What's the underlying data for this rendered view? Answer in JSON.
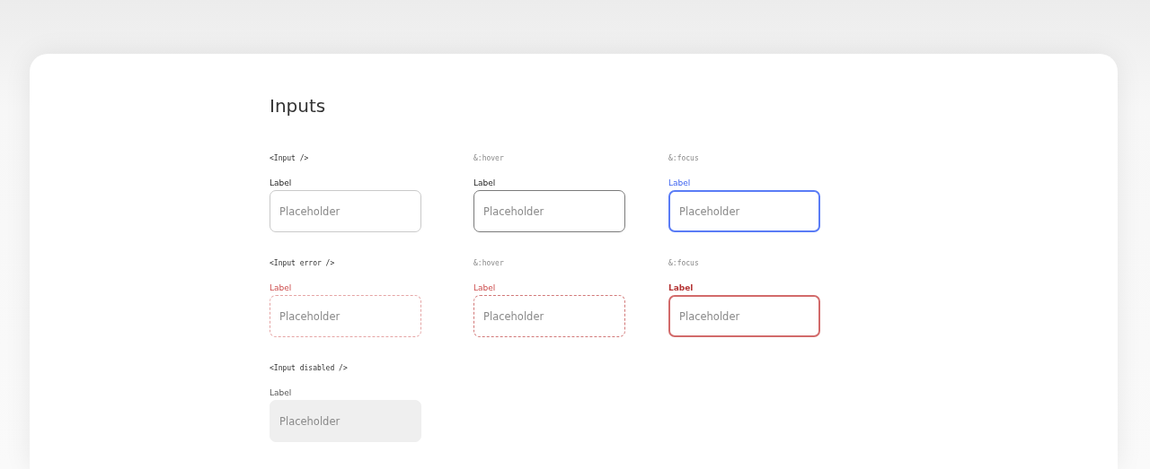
{
  "title": "Inputs",
  "rows": [
    {
      "cells": [
        {
          "caption": "<Input />",
          "label": "Label",
          "placeholder": "Placeholder",
          "hovered": false,
          "focused": false,
          "error": false,
          "disabled": false
        },
        {
          "caption": "&:hover",
          "label": "Label",
          "placeholder": "Placeholder",
          "hovered": true,
          "focused": false,
          "error": false,
          "disabled": false
        },
        {
          "caption": "&:focus",
          "label": "Label",
          "placeholder": "Placeholder",
          "hovered": false,
          "focused": true,
          "error": false,
          "disabled": false
        }
      ]
    },
    {
      "cells": [
        {
          "caption": "<Input error />",
          "label": "Label",
          "placeholder": "Placeholder",
          "hovered": false,
          "focused": false,
          "error": true,
          "disabled": false
        },
        {
          "caption": "&:hover",
          "label": "Label",
          "placeholder": "Placeholder",
          "hovered": true,
          "focused": false,
          "error": true,
          "disabled": false
        },
        {
          "caption": "&:focus",
          "label": "Label",
          "placeholder": "Placeholder",
          "hovered": false,
          "focused": true,
          "error": true,
          "disabled": false
        }
      ]
    },
    {
      "cells": [
        {
          "caption": "<Input disabled />",
          "label": "Label",
          "placeholder": "Placeholder",
          "hovered": false,
          "focused": false,
          "error": false,
          "disabled": true
        }
      ]
    }
  ]
}
